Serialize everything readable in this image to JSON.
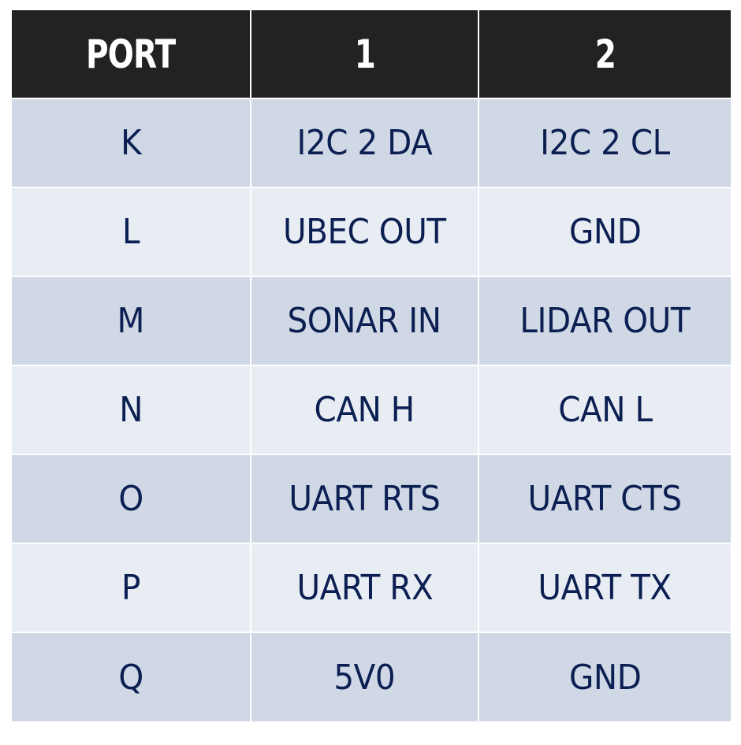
{
  "table": {
    "headers": [
      "PORT",
      "1",
      "2"
    ],
    "rows": [
      [
        "K",
        "I2C 2 DA",
        "I2C 2 CL"
      ],
      [
        "L",
        "UBEC OUT",
        "GND"
      ],
      [
        "M",
        "SONAR IN",
        "LIDAR OUT"
      ],
      [
        "N",
        "CAN H",
        "CAN L"
      ],
      [
        "O",
        "UART RTS",
        "UART CTS"
      ],
      [
        "P",
        "UART RX",
        "UART TX"
      ],
      [
        "Q",
        "5V0",
        "GND"
      ]
    ]
  },
  "colors": {
    "header_bg": "#222222",
    "header_text": "#ffffff",
    "row_odd_bg": "#d0d8e6",
    "row_even_bg": "#e8edf4",
    "cell_text": "#0b1f52"
  }
}
